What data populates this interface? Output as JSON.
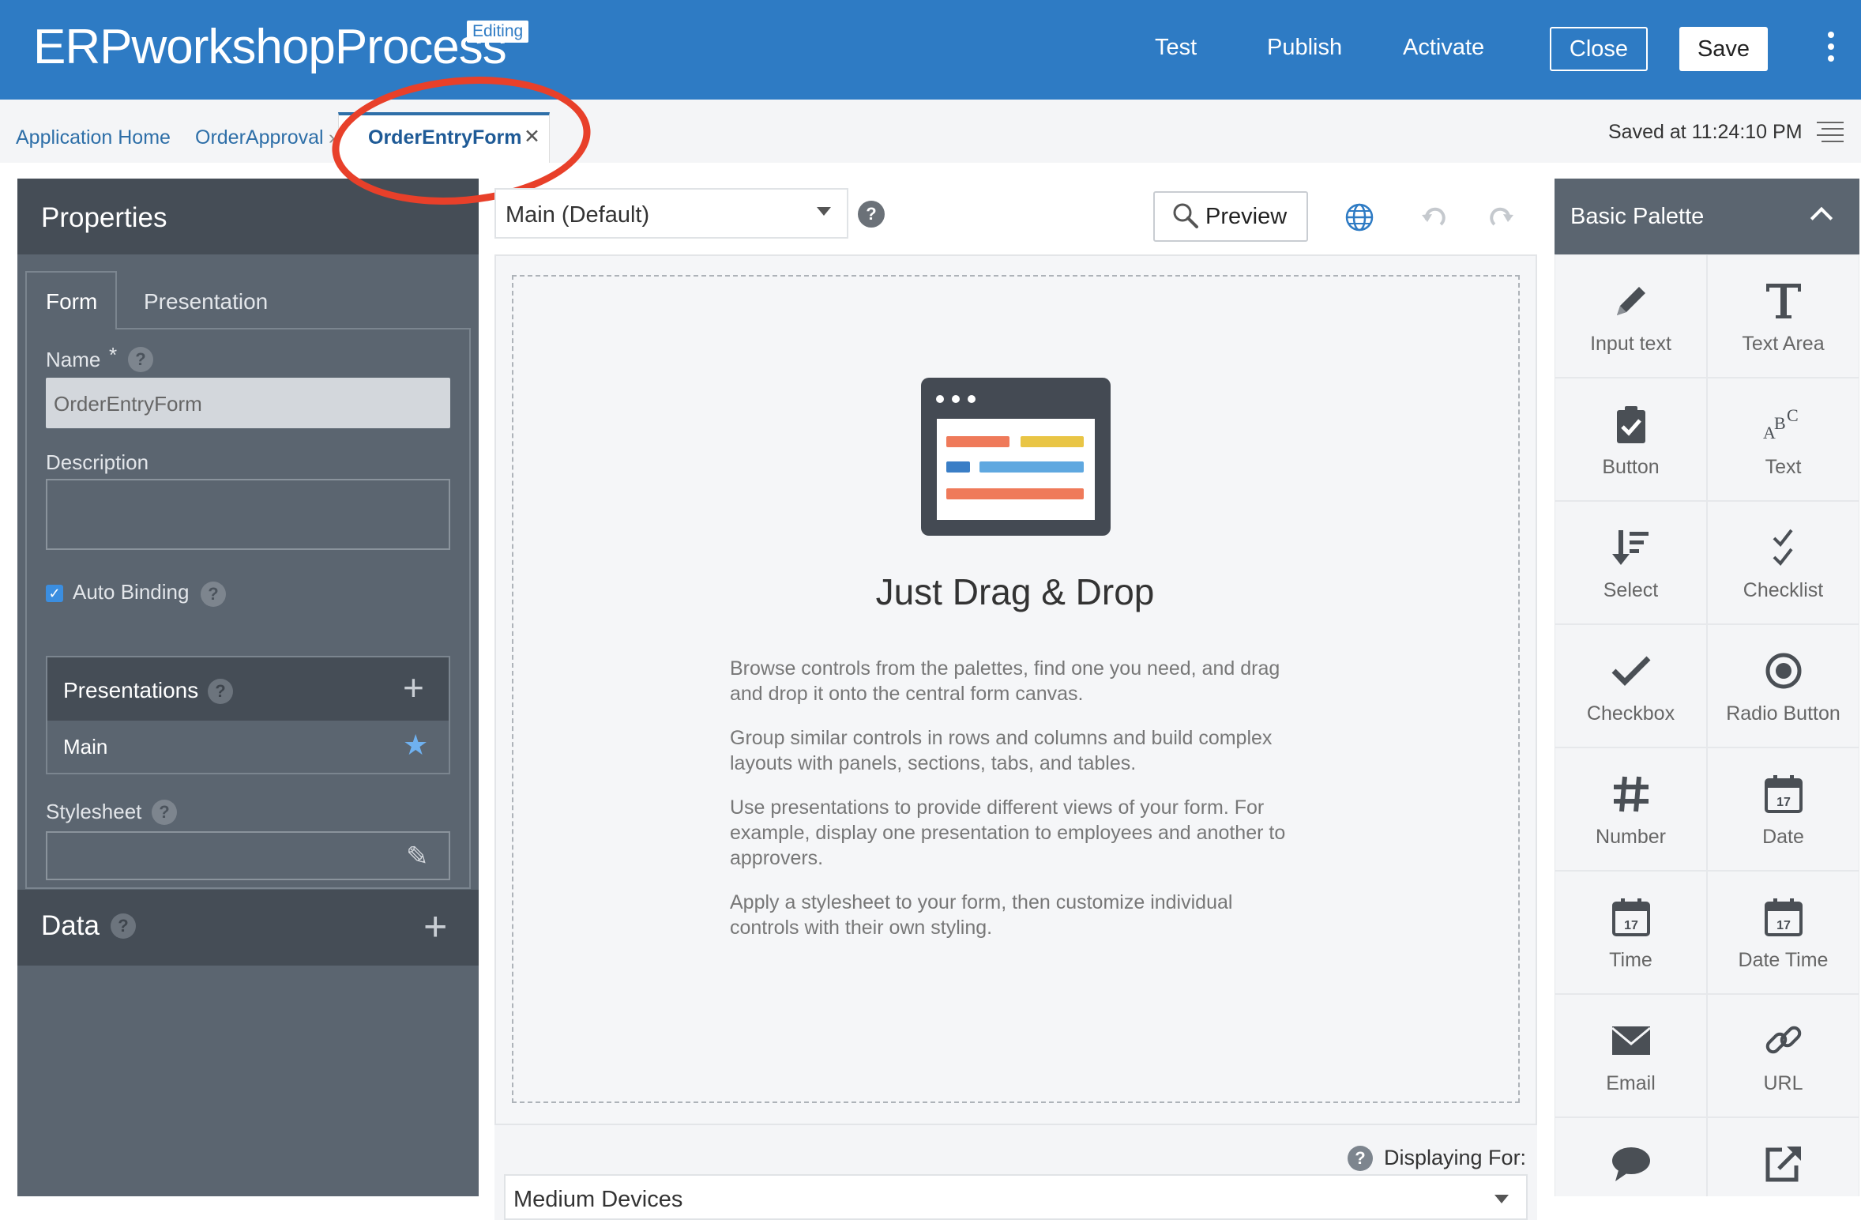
{
  "header": {
    "app_title": "ERPworkshopProcess",
    "badge": "Editing",
    "test": "Test",
    "publish": "Publish",
    "activate": "Activate",
    "close": "Close",
    "save": "Save"
  },
  "breadcrumb": {
    "items": [
      "Application Home",
      "OrderApproval"
    ],
    "active_tab": "OrderEntryForm",
    "saved_at": "Saved at 11:24:10 PM"
  },
  "properties": {
    "title": "Properties",
    "tabs": [
      "Form",
      "Presentation"
    ],
    "name_label": "Name",
    "required_mark": "*",
    "name_value": "OrderEntryForm",
    "description_label": "Description",
    "auto_binding_label": "Auto Binding",
    "auto_binding_checked": true,
    "presentations_label": "Presentations",
    "presentation_main": "Main",
    "stylesheet_label": "Stylesheet"
  },
  "data_panel": {
    "title": "Data"
  },
  "canvas": {
    "presentation_select": "Main (Default)",
    "preview": "Preview",
    "title": "Just Drag & Drop",
    "paragraphs": [
      "Browse controls from the palettes, find one you need, and drag and drop it onto the central form canvas.",
      "Group similar controls in rows and columns and build complex layouts with panels, sections, tabs, and tables.",
      "Use presentations to provide different views of your form. For example, display one presentation to employees and another to approvers.",
      "Apply a stylesheet to your form, then customize individual controls with their own styling."
    ],
    "displaying_for_label": "Displaying For:",
    "device_select": "Medium Devices"
  },
  "palette": {
    "title": "Basic Palette",
    "items": [
      {
        "label": "Input text",
        "icon": "pencil-icon"
      },
      {
        "label": "Text Area",
        "icon": "text-area-icon"
      },
      {
        "label": "Button",
        "icon": "clipboard-check-icon"
      },
      {
        "label": "Text",
        "icon": "abc-icon"
      },
      {
        "label": "Select",
        "icon": "sort-list-icon"
      },
      {
        "label": "Checklist",
        "icon": "checklist-icon"
      },
      {
        "label": "Checkbox",
        "icon": "checkmark-icon"
      },
      {
        "label": "Radio Button",
        "icon": "radio-icon"
      },
      {
        "label": "Number",
        "icon": "hash-icon"
      },
      {
        "label": "Date",
        "icon": "calendar-icon"
      },
      {
        "label": "Time",
        "icon": "calendar-icon"
      },
      {
        "label": "Date Time",
        "icon": "calendar-icon"
      },
      {
        "label": "Email",
        "icon": "envelope-icon"
      },
      {
        "label": "URL",
        "icon": "link-icon"
      },
      {
        "label": "",
        "icon": "speech-bubble-icon"
      },
      {
        "label": "",
        "icon": "external-link-icon"
      }
    ]
  },
  "calendar_day": "17",
  "colors": {
    "header_blue": "#2e7bc4",
    "panel_dark": "#454d56",
    "panel": "#5b6570",
    "annotation_red": "#e8402a"
  }
}
